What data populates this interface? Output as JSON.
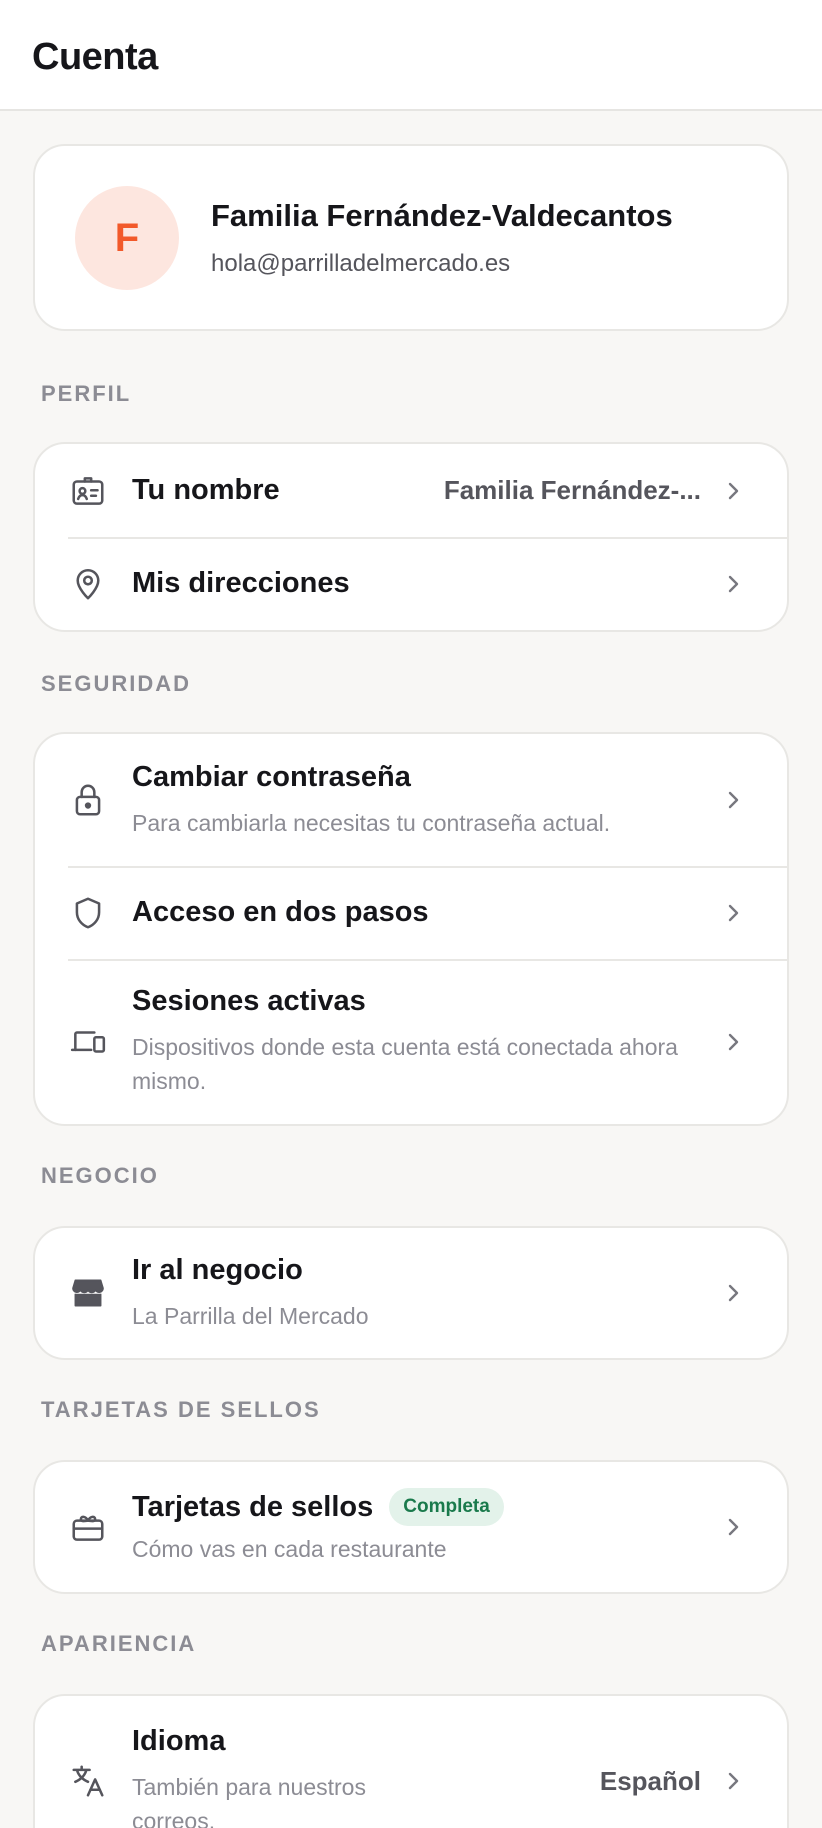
{
  "header": {
    "title": "Cuenta"
  },
  "profile": {
    "initial": "F",
    "name": "Familia Fernández-Valdecantos",
    "email": "hola@parrilladelmercado.es"
  },
  "sections": {
    "perfil": {
      "label": "PERFIL",
      "name": {
        "title": "Tu nombre",
        "value": "Familia Fernández-..."
      },
      "addresses": {
        "title": "Mis direcciones"
      }
    },
    "seguridad": {
      "label": "SEGURIDAD",
      "password": {
        "title": "Cambiar contraseña",
        "subtitle": "Para cambiarla necesitas tu contraseña actual."
      },
      "two_step": {
        "title": "Acceso en dos pasos"
      },
      "sessions": {
        "title": "Sesiones activas",
        "subtitle": "Dispositivos donde esta cuenta está conectada ahora mismo."
      }
    },
    "negocio": {
      "label": "NEGOCIO",
      "business": {
        "title": "Ir al negocio",
        "subtitle": "La Parrilla del Mercado"
      }
    },
    "tarjetas": {
      "label": "TARJETAS DE SELLOS",
      "cards": {
        "title": "Tarjetas de sellos",
        "badge": "Completa",
        "subtitle": "Cómo vas en cada restaurante"
      }
    },
    "apariencia": {
      "label": "APARIENCIA",
      "language": {
        "title": "Idioma",
        "subtitle": "También para nuestros correos.",
        "value": "Español"
      }
    }
  },
  "colors": {
    "accent": "#f2592a",
    "avatar_bg": "#fde6df",
    "badge_bg": "#e3f2ea",
    "badge_text": "#1a7a4c",
    "background": "#f8f7f5"
  },
  "icons": {
    "name": "id-badge-icon",
    "addresses": "map-pin-icon",
    "password": "lock-icon",
    "two_step": "shield-icon",
    "sessions": "devices-icon",
    "business": "storefront-icon",
    "cards": "stamp-card-icon",
    "language": "translate-icon",
    "row": "chevron-right-icon"
  }
}
